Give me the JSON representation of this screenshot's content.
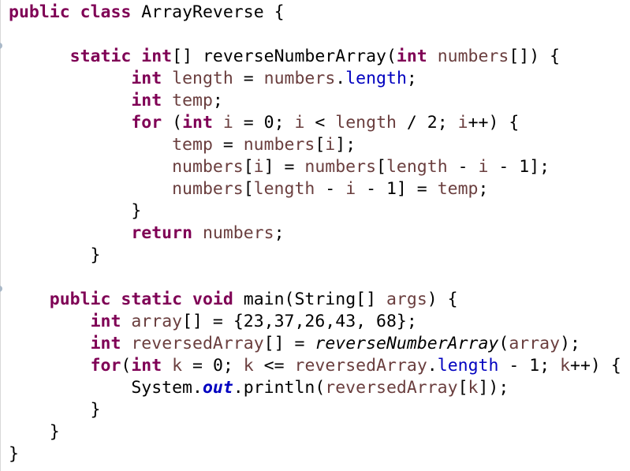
{
  "editor": {
    "language": "java",
    "colors": {
      "keyword": "#7f0055",
      "local_variable": "#6a3e3e",
      "field": "#0000c0",
      "plain": "#000000",
      "background": "#ffffff"
    },
    "lines": [
      [
        {
          "t": "public",
          "c": "kw"
        },
        {
          "t": " ",
          "c": "plain"
        },
        {
          "t": "class",
          "c": "kw"
        },
        {
          "t": " ArrayReverse {",
          "c": "plain"
        }
      ],
      [],
      [
        {
          "t": "      ",
          "c": "plain"
        },
        {
          "t": "static",
          "c": "kw"
        },
        {
          "t": " ",
          "c": "plain"
        },
        {
          "t": "int",
          "c": "kw"
        },
        {
          "t": "[] reverseNumberArray(",
          "c": "plain"
        },
        {
          "t": "int",
          "c": "kw"
        },
        {
          "t": " ",
          "c": "plain"
        },
        {
          "t": "numbers",
          "c": "var"
        },
        {
          "t": "[]) {",
          "c": "plain"
        }
      ],
      [
        {
          "t": "            ",
          "c": "plain"
        },
        {
          "t": "int",
          "c": "kw"
        },
        {
          "t": " ",
          "c": "plain"
        },
        {
          "t": "length",
          "c": "var"
        },
        {
          "t": " = ",
          "c": "plain"
        },
        {
          "t": "numbers",
          "c": "var"
        },
        {
          "t": ".",
          "c": "plain"
        },
        {
          "t": "length",
          "c": "field"
        },
        {
          "t": ";",
          "c": "plain"
        }
      ],
      [
        {
          "t": "            ",
          "c": "plain"
        },
        {
          "t": "int",
          "c": "kw"
        },
        {
          "t": " ",
          "c": "plain"
        },
        {
          "t": "temp",
          "c": "var"
        },
        {
          "t": ";",
          "c": "plain"
        }
      ],
      [
        {
          "t": "            ",
          "c": "plain"
        },
        {
          "t": "for",
          "c": "kw"
        },
        {
          "t": " (",
          "c": "plain"
        },
        {
          "t": "int",
          "c": "kw"
        },
        {
          "t": " ",
          "c": "plain"
        },
        {
          "t": "i",
          "c": "var"
        },
        {
          "t": " = 0; ",
          "c": "plain"
        },
        {
          "t": "i",
          "c": "var"
        },
        {
          "t": " < ",
          "c": "plain"
        },
        {
          "t": "length",
          "c": "var"
        },
        {
          "t": " / 2; ",
          "c": "plain"
        },
        {
          "t": "i",
          "c": "var"
        },
        {
          "t": "++) {",
          "c": "plain"
        }
      ],
      [
        {
          "t": "                ",
          "c": "plain"
        },
        {
          "t": "temp",
          "c": "var"
        },
        {
          "t": " = ",
          "c": "plain"
        },
        {
          "t": "numbers",
          "c": "var"
        },
        {
          "t": "[",
          "c": "plain"
        },
        {
          "t": "i",
          "c": "var"
        },
        {
          "t": "];",
          "c": "plain"
        }
      ],
      [
        {
          "t": "                ",
          "c": "plain"
        },
        {
          "t": "numbers",
          "c": "var"
        },
        {
          "t": "[",
          "c": "plain"
        },
        {
          "t": "i",
          "c": "var"
        },
        {
          "t": "] = ",
          "c": "plain"
        },
        {
          "t": "numbers",
          "c": "var"
        },
        {
          "t": "[",
          "c": "plain"
        },
        {
          "t": "length",
          "c": "var"
        },
        {
          "t": " - ",
          "c": "plain"
        },
        {
          "t": "i",
          "c": "var"
        },
        {
          "t": " - 1];",
          "c": "plain"
        }
      ],
      [
        {
          "t": "                ",
          "c": "plain"
        },
        {
          "t": "numbers",
          "c": "var"
        },
        {
          "t": "[",
          "c": "plain"
        },
        {
          "t": "length",
          "c": "var"
        },
        {
          "t": " - ",
          "c": "plain"
        },
        {
          "t": "i",
          "c": "var"
        },
        {
          "t": " - 1] = ",
          "c": "plain"
        },
        {
          "t": "temp",
          "c": "var"
        },
        {
          "t": ";",
          "c": "plain"
        }
      ],
      [
        {
          "t": "            }",
          "c": "plain"
        }
      ],
      [
        {
          "t": "            ",
          "c": "plain"
        },
        {
          "t": "return",
          "c": "kw"
        },
        {
          "t": " ",
          "c": "plain"
        },
        {
          "t": "numbers",
          "c": "var"
        },
        {
          "t": ";",
          "c": "plain"
        }
      ],
      [
        {
          "t": "        }",
          "c": "plain"
        }
      ],
      [],
      [
        {
          "t": "    ",
          "c": "plain"
        },
        {
          "t": "public",
          "c": "kw"
        },
        {
          "t": " ",
          "c": "plain"
        },
        {
          "t": "static",
          "c": "kw"
        },
        {
          "t": " ",
          "c": "plain"
        },
        {
          "t": "void",
          "c": "kw"
        },
        {
          "t": " main(String[] ",
          "c": "plain"
        },
        {
          "t": "args",
          "c": "var"
        },
        {
          "t": ") {",
          "c": "plain"
        }
      ],
      [
        {
          "t": "        ",
          "c": "plain"
        },
        {
          "t": "int",
          "c": "kw"
        },
        {
          "t": " ",
          "c": "plain"
        },
        {
          "t": "array",
          "c": "var"
        },
        {
          "t": "[] = {23,37,26,43, 68};",
          "c": "plain"
        }
      ],
      [
        {
          "t": "        ",
          "c": "plain"
        },
        {
          "t": "int",
          "c": "kw"
        },
        {
          "t": " ",
          "c": "plain"
        },
        {
          "t": "reversedArray",
          "c": "var"
        },
        {
          "t": "[] = ",
          "c": "plain"
        },
        {
          "t": "reverseNumberArray",
          "c": "static-method"
        },
        {
          "t": "(",
          "c": "plain"
        },
        {
          "t": "array",
          "c": "var"
        },
        {
          "t": ");",
          "c": "plain"
        }
      ],
      [
        {
          "t": "        ",
          "c": "plain"
        },
        {
          "t": "for",
          "c": "kw"
        },
        {
          "t": "(",
          "c": "plain"
        },
        {
          "t": "int",
          "c": "kw"
        },
        {
          "t": " ",
          "c": "plain"
        },
        {
          "t": "k",
          "c": "var"
        },
        {
          "t": " = 0; ",
          "c": "plain"
        },
        {
          "t": "k",
          "c": "var"
        },
        {
          "t": " <= ",
          "c": "plain"
        },
        {
          "t": "reversedArray",
          "c": "var"
        },
        {
          "t": ".",
          "c": "plain"
        },
        {
          "t": "length",
          "c": "field"
        },
        {
          "t": " - 1; ",
          "c": "plain"
        },
        {
          "t": "k",
          "c": "var"
        },
        {
          "t": "++) {",
          "c": "plain"
        }
      ],
      [
        {
          "t": "            System.",
          "c": "plain"
        },
        {
          "t": "out",
          "c": "static-field"
        },
        {
          "t": ".println(",
          "c": "plain"
        },
        {
          "t": "reversedArray",
          "c": "var"
        },
        {
          "t": "[",
          "c": "plain"
        },
        {
          "t": "k",
          "c": "var"
        },
        {
          "t": "]);",
          "c": "plain"
        }
      ],
      [
        {
          "t": "        }",
          "c": "plain"
        }
      ],
      [
        {
          "t": "    }",
          "c": "plain"
        }
      ],
      [
        {
          "t": "}",
          "c": "plain"
        }
      ]
    ],
    "folding_marker_lines": [
      2,
      13
    ]
  }
}
